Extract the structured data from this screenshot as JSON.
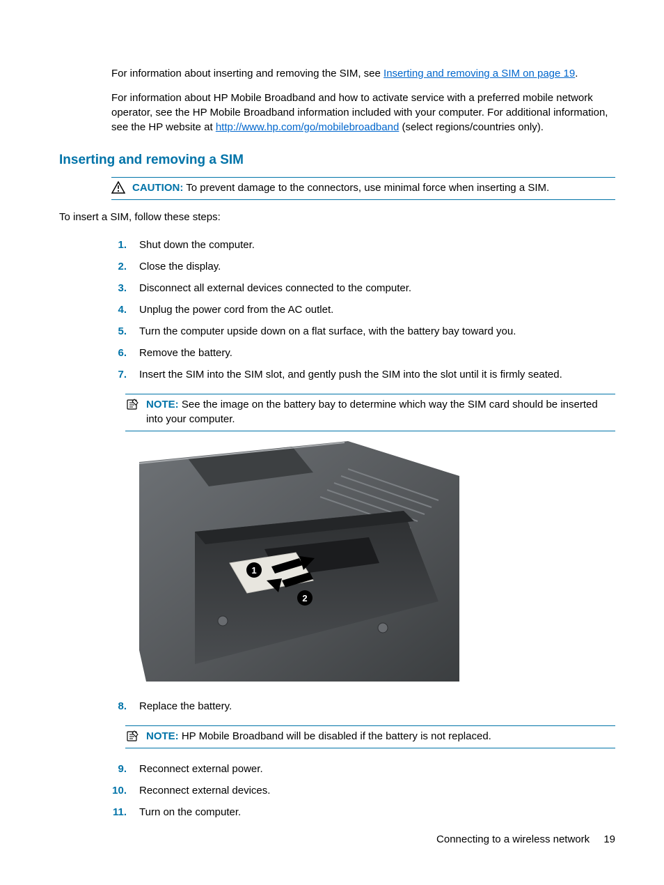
{
  "intro": {
    "p1_pre": "For information about inserting and removing the SIM, see ",
    "p1_link": "Inserting and removing a SIM on page 19",
    "p1_post": ".",
    "p2_pre": "For information about HP Mobile Broadband and how to activate service with a preferred mobile network operator, see the HP Mobile Broadband information included with your computer. For additional information, see the HP website at ",
    "p2_link": "http://www.hp.com/go/mobilebroadband",
    "p2_post": " (select regions/countries only)."
  },
  "heading": "Inserting and removing a SIM",
  "caution": {
    "label": "CAUTION:",
    "text": "To prevent damage to the connectors, use minimal force when inserting a SIM."
  },
  "lead_in": "To insert a SIM, follow these steps:",
  "steps_a": {
    "1": "Shut down the computer.",
    "2": "Close the display.",
    "3": "Disconnect all external devices connected to the computer.",
    "4": "Unplug the power cord from the AC outlet.",
    "5": "Turn the computer upside down on a flat surface, with the battery bay toward you.",
    "6": "Remove the battery.",
    "7": "Insert the SIM into the SIM slot, and gently push the SIM into the slot until it is firmly seated."
  },
  "note1": {
    "label": "NOTE:",
    "text": "See the image on the battery bay to determine which way the SIM card should be inserted into your computer."
  },
  "steps_b": {
    "8": "Replace the battery."
  },
  "note2": {
    "label": "NOTE:",
    "text": "HP Mobile Broadband will be disabled if the battery is not replaced."
  },
  "steps_c": {
    "9": "Reconnect external power.",
    "10": "Reconnect external devices.",
    "11": "Turn on the computer."
  },
  "footer": {
    "section": "Connecting to a wireless network",
    "page": "19"
  }
}
